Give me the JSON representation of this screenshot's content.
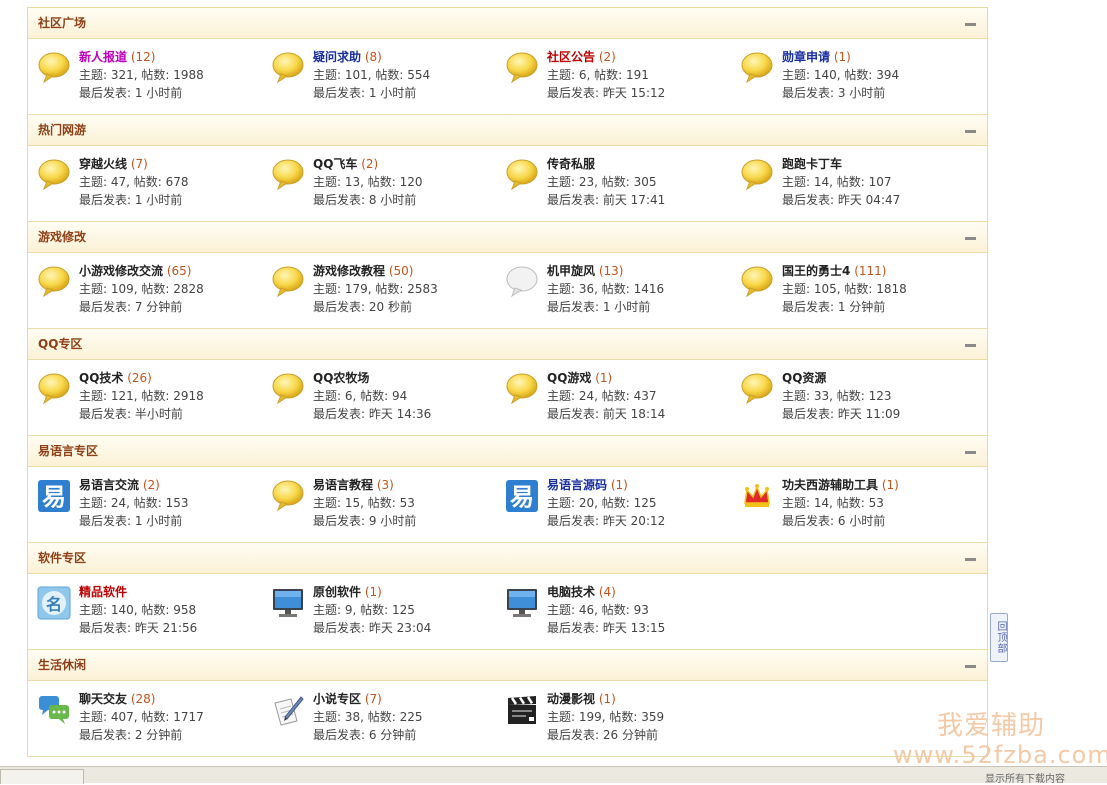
{
  "sections": [
    {
      "title": "社区广场",
      "forums": [
        {
          "name": "新人报道",
          "count": "(12)",
          "style": "purple",
          "icon": "speech-bubble-icon",
          "topics": "主题: 321, 帖数: 1988",
          "last": "最后发表: 1 小时前"
        },
        {
          "name": "疑问求助",
          "count": "(8)",
          "style": "navy",
          "icon": "speech-bubble-icon",
          "topics": "主题: 101, 帖数: 554",
          "last": "最后发表: 1 小时前"
        },
        {
          "name": "社区公告",
          "count": "(2)",
          "style": "red",
          "icon": "speech-bubble-icon",
          "topics": "主题: 6, 帖数: 191",
          "last": "最后发表: 昨天 15:12"
        },
        {
          "name": "勋章申请",
          "count": "(1)",
          "style": "navy",
          "icon": "speech-bubble-icon",
          "topics": "主题: 140, 帖数: 394",
          "last": "最后发表: 3 小时前"
        }
      ]
    },
    {
      "title": "热门网游",
      "forums": [
        {
          "name": "穿越火线",
          "count": "(7)",
          "style": "",
          "icon": "speech-bubble-icon",
          "topics": "主题: 47, 帖数: 678",
          "last": "最后发表: 1 小时前"
        },
        {
          "name": "QQ飞车",
          "count": "(2)",
          "style": "",
          "icon": "speech-bubble-icon",
          "topics": "主题: 13, 帖数: 120",
          "last": "最后发表: 8 小时前"
        },
        {
          "name": "传奇私服",
          "count": "",
          "style": "",
          "icon": "speech-bubble-icon",
          "topics": "主题: 23, 帖数: 305",
          "last": "最后发表: 前天 17:41"
        },
        {
          "name": "跑跑卡丁车",
          "count": "",
          "style": "",
          "icon": "speech-bubble-icon",
          "topics": "主题: 14, 帖数: 107",
          "last": "最后发表: 昨天 04:47"
        }
      ]
    },
    {
      "title": "游戏修改",
      "forums": [
        {
          "name": "小游戏修改交流",
          "count": "(65)",
          "style": "",
          "icon": "speech-bubble-icon",
          "topics": "主题: 109, 帖数: 2828",
          "last": "最后发表: 7 分钟前"
        },
        {
          "name": "游戏修改教程",
          "count": "(50)",
          "style": "",
          "icon": "speech-bubble-icon",
          "topics": "主题: 179, 帖数: 2583",
          "last": "最后发表: 20 秒前"
        },
        {
          "name": "机甲旋风",
          "count": "(13)",
          "style": "",
          "icon": "speech-bubble-grey-icon",
          "topics": "主题: 36, 帖数: 1416",
          "last": "最后发表: 1 小时前"
        },
        {
          "name": "国王的勇士4",
          "count": "(111)",
          "style": "",
          "icon": "speech-bubble-icon",
          "topics": "主题: 105, 帖数: 1818",
          "last": "最后发表: 1 分钟前"
        }
      ]
    },
    {
      "title": "QQ专区",
      "forums": [
        {
          "name": "QQ技术",
          "count": "(26)",
          "style": "",
          "icon": "speech-bubble-icon",
          "topics": "主题: 121, 帖数: 2918",
          "last": "最后发表: 半小时前"
        },
        {
          "name": "QQ农牧场",
          "count": "",
          "style": "",
          "icon": "speech-bubble-icon",
          "topics": "主题: 6, 帖数: 94",
          "last": "最后发表: 昨天 14:36"
        },
        {
          "name": "QQ游戏",
          "count": "(1)",
          "style": "",
          "icon": "speech-bubble-icon",
          "topics": "主题: 24, 帖数: 437",
          "last": "最后发表: 前天 18:14"
        },
        {
          "name": "QQ资源",
          "count": "",
          "style": "",
          "icon": "speech-bubble-icon",
          "topics": "主题: 33, 帖数: 123",
          "last": "最后发表: 昨天 11:09"
        }
      ]
    },
    {
      "title": "易语言专区",
      "forums": [
        {
          "name": "易语言交流",
          "count": "(2)",
          "style": "",
          "icon": "yi-language-icon",
          "topics": "主题: 24, 帖数: 153",
          "last": "最后发表: 1 小时前"
        },
        {
          "name": "易语言教程",
          "count": "(3)",
          "style": "",
          "icon": "speech-bubble-icon",
          "topics": "主题: 15, 帖数: 53",
          "last": "最后发表: 9 小时前"
        },
        {
          "name": "易语言源码",
          "count": "(1)",
          "style": "navy",
          "icon": "yi-language-icon",
          "topics": "主题: 20, 帖数: 125",
          "last": "最后发表: 昨天 20:12"
        },
        {
          "name": "功夫西游辅助工具",
          "count": "(1)",
          "style": "",
          "icon": "crown-icon",
          "topics": "主题: 14, 帖数: 53",
          "last": "最后发表: 6 小时前"
        }
      ]
    },
    {
      "title": "软件专区",
      "forums": [
        {
          "name": "精品软件",
          "count": "",
          "style": "red",
          "icon": "ming-badge-icon",
          "topics": "主题: 140, 帖数: 958",
          "last": "最后发表: 昨天 21:56"
        },
        {
          "name": "原创软件",
          "count": "(1)",
          "style": "",
          "icon": "monitor-icon",
          "topics": "主题: 9, 帖数: 125",
          "last": "最后发表: 昨天 23:04"
        },
        {
          "name": "电脑技术",
          "count": "(4)",
          "style": "",
          "icon": "monitor-icon",
          "topics": "主题: 46, 帖数: 93",
          "last": "最后发表: 昨天 13:15"
        }
      ]
    },
    {
      "title": "生活休闲",
      "forums": [
        {
          "name": "聊天交友",
          "count": "(28)",
          "style": "",
          "icon": "chat-bubbles-icon",
          "topics": "主题: 407, 帖数: 1717",
          "last": "最后发表: 2 分钟前"
        },
        {
          "name": "小说专区",
          "count": "(7)",
          "style": "",
          "icon": "pen-paper-icon",
          "topics": "主题: 38, 帖数: 225",
          "last": "最后发表: 6 分钟前"
        },
        {
          "name": "动漫影视",
          "count": "(1)",
          "style": "",
          "icon": "clapperboard-icon",
          "topics": "主题: 199, 帖数: 359",
          "last": "最后发表: 26 分钟前"
        }
      ]
    }
  ],
  "back_to_top": "回顶部",
  "watermark": {
    "cn": "我爱辅助",
    "url": "www.52fzba.com"
  },
  "status_text": "显示所有下载内容"
}
